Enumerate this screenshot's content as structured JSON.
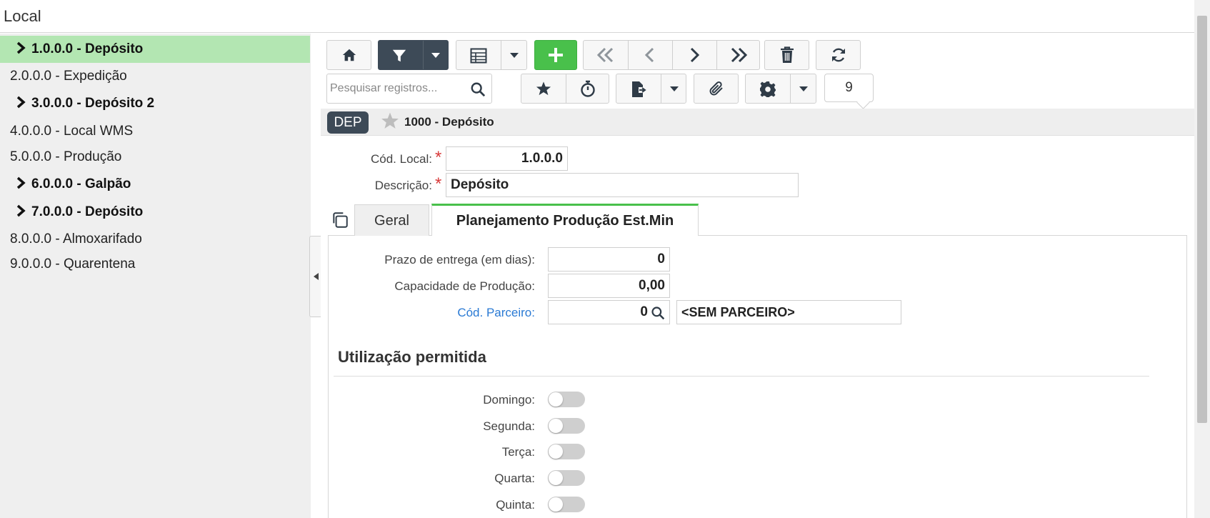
{
  "window": {
    "title": "Local"
  },
  "sidebar": {
    "items": [
      {
        "label": "1.0.0.0 - Depósito",
        "folder": true,
        "selected": true
      },
      {
        "label": "2.0.0.0 - Expedição",
        "folder": false
      },
      {
        "label": "3.0.0.0 - Depósito 2",
        "folder": true
      },
      {
        "label": "4.0.0.0 - Local WMS",
        "folder": false
      },
      {
        "label": "5.0.0.0 - Produção",
        "folder": false
      },
      {
        "label": "6.0.0.0 - Galpão",
        "folder": true
      },
      {
        "label": "7.0.0.0 - Depósito",
        "folder": true
      },
      {
        "label": "8.0.0.0 - Almoxarifado",
        "folder": false
      },
      {
        "label": "9.0.0.0 - Quarentena",
        "folder": false
      }
    ]
  },
  "toolbar": {
    "search_placeholder": "Pesquisar registros...",
    "record_count": "9",
    "add_color": "#49c04b",
    "filter_color": "#3d4a57"
  },
  "record": {
    "badge": "DEP",
    "title": "1000 - Depósito",
    "cod_local_label": "Cód. Local:",
    "cod_local_value": "1.0.0.0",
    "descricao_label": "Descrição:",
    "descricao_value": "Depósito"
  },
  "tabs": [
    {
      "label": "Geral",
      "active": false
    },
    {
      "label": "Planejamento Produção Est.Min",
      "active": true
    }
  ],
  "planning": {
    "prazo_label": "Prazo de entrega (em dias):",
    "prazo_value": "0",
    "capacidade_label": "Capacidade de Produção:",
    "capacidade_value": "0,00",
    "parceiro_label": "Cód. Parceiro:",
    "parceiro_code": "0",
    "parceiro_name": "<SEM PARCEIRO>"
  },
  "usage": {
    "title": "Utilização permitida",
    "days": [
      {
        "label": "Domingo:",
        "on": false
      },
      {
        "label": "Segunda:",
        "on": false
      },
      {
        "label": "Terça:",
        "on": false
      },
      {
        "label": "Quarta:",
        "on": false
      },
      {
        "label": "Quinta:",
        "on": false
      }
    ]
  }
}
